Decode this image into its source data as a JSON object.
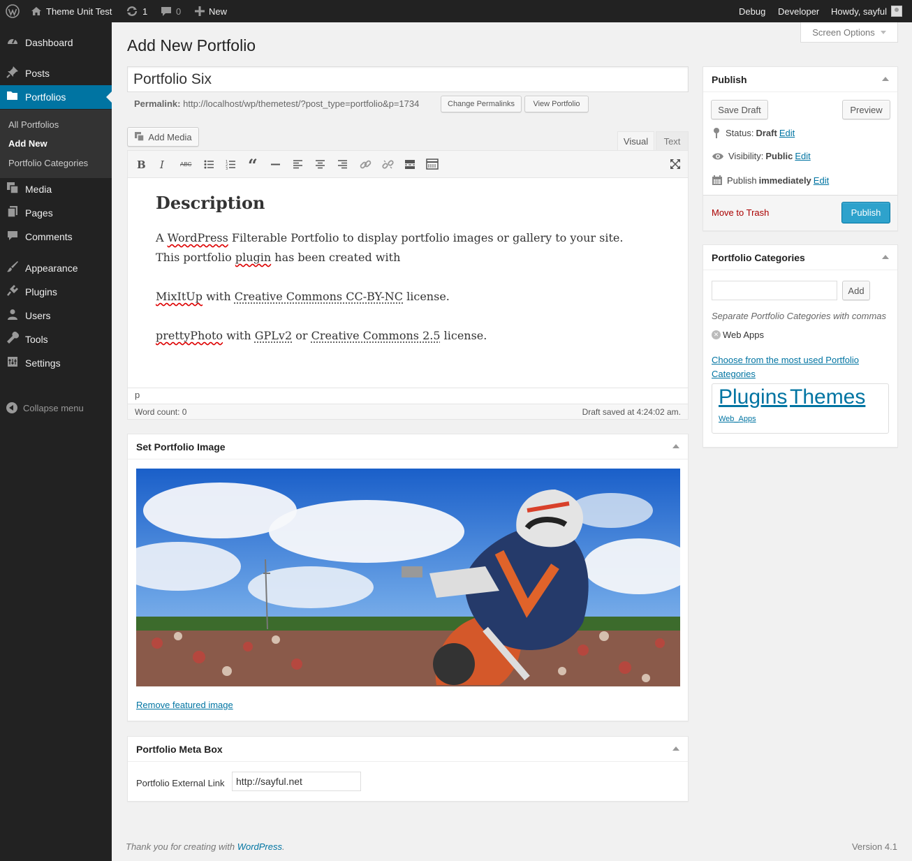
{
  "adminbar": {
    "site_name": "Theme Unit Test",
    "updates_count": "1",
    "comments_count": "0",
    "new_label": "New",
    "debug_label": "Debug",
    "developer_label": "Developer",
    "howdy_label": "Howdy, sayful"
  },
  "menu": {
    "dashboard": "Dashboard",
    "posts": "Posts",
    "portfolios": "Portfolios",
    "submenu": [
      "All Portfolios",
      "Add New",
      "Portfolio Categories"
    ],
    "media": "Media",
    "pages": "Pages",
    "comments": "Comments",
    "appearance": "Appearance",
    "plugins": "Plugins",
    "users": "Users",
    "tools": "Tools",
    "settings": "Settings",
    "collapse": "Collapse menu"
  },
  "screen_options": "Screen Options",
  "page_title": "Add New Portfolio",
  "post_title": "Portfolio Six",
  "permalink": {
    "label": "Permalink:",
    "url": "http://localhost/wp/themetest/?post_type=portfolio&p=1734",
    "change_btn": "Change Permalinks",
    "view_btn": "View Portfolio"
  },
  "editor": {
    "add_media": "Add Media",
    "tab_visual": "Visual",
    "tab_text": "Text",
    "heading": "Description",
    "p1_a": "A ",
    "p1_wp": "WordPress",
    "p1_b": " Filterable Portfolio to display portfolio images or gallery to your site.",
    "p2_a": "This portfolio ",
    "p2_plugin": "plugin",
    "p2_b": " has been created with",
    "p3_mix": "MixItUp",
    "p3_a": " with ",
    "p3_cc": "Creative Commons ",
    "p3_ccnc": "CC-BY-NC",
    "p3_b": " license.",
    "p4_pretty": "prettyPhoto",
    "p4_a": " with ",
    "p4_gpl": "GPLv2",
    "p4_or": " or ",
    "p4_cc": "Creative Commons 2.5",
    "p4_b": " license.",
    "path": "p",
    "word_count": "Word count: 0",
    "draft_saved": "Draft saved at 4:24:02 am."
  },
  "image_box": {
    "title": "Set Portfolio Image",
    "remove_link": "Remove featured image"
  },
  "meta_box": {
    "title": "Portfolio Meta Box",
    "label": "Portfolio External Link",
    "value": "http://sayful.net"
  },
  "publish": {
    "title": "Publish",
    "save_draft": "Save Draft",
    "preview": "Preview",
    "status_label": "Status:",
    "status_value": "Draft",
    "visibility_label": "Visibility:",
    "visibility_value": "Public",
    "publish_label": "Publish",
    "publish_value": "immediately",
    "edit": "Edit",
    "trash": "Move to Trash",
    "publish_btn": "Publish"
  },
  "categories": {
    "title": "Portfolio Categories",
    "add_btn": "Add",
    "hint": "Separate Portfolio Categories with commas",
    "tag": "Web Apps",
    "choose_link": "Choose from the most used Portfolio Categories",
    "cloud_1": "Plugins",
    "cloud_2": "Themes",
    "cloud_3": "Web_Apps"
  },
  "footer": {
    "thanks_a": "Thank you for creating with ",
    "thanks_link": "WordPress",
    "thanks_b": ".",
    "version": "Version 4.1"
  },
  "colors": {
    "accent": "#0074a2",
    "admin_bar": "#222222",
    "trash": "#a00000",
    "publish_button": "#2ea2cc"
  }
}
